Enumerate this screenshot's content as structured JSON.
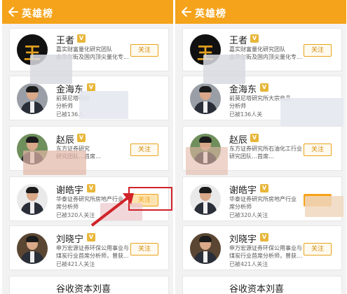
{
  "app": {
    "title": "英雄榜",
    "accent_color": "#f5a31a",
    "back_icon": "arrow-left-icon"
  },
  "experts_left": [
    {
      "name": "王者",
      "badge": "V",
      "desc1": "嘉实财富量化研究团队",
      "desc2": "由华尔街及国内顶尖量化专...",
      "followers": "",
      "follow": "关注",
      "avatar": "logo"
    },
    {
      "name": "金海东",
      "badge": "V",
      "desc1": "前莫尼塔研究",
      "desc2": "分析师",
      "followers": "已被136人",
      "follow": "",
      "avatar": "person"
    },
    {
      "name": "赵辰",
      "badge": "V",
      "desc1": "东方证券研究",
      "desc2": "研究团队…首席…",
      "followers": "",
      "follow": "关注",
      "avatar": "person"
    },
    {
      "name": "谢皓宇",
      "badge": "V",
      "desc1": "华泰证券研究所房地产行业",
      "desc2": "席分析师",
      "followers": "已被320人关注",
      "follow": "关注",
      "avatar": "person"
    },
    {
      "name": "刘晓宁",
      "badge": "V",
      "desc1": "申万宏源证券环保公用事业与",
      "desc2": "煤炭行业首席分析师，曾获...",
      "followers": "已被421人关注",
      "follow": "关注",
      "avatar": "person"
    },
    {
      "name": "谷收资本刘喜",
      "partial": true
    }
  ],
  "experts_right": [
    {
      "name": "王者",
      "badge": "V",
      "desc1": "嘉实财富量化研究团队",
      "desc2": "由华尔街及国内顶尖量化专...",
      "follow": "关注",
      "avatar": "logo"
    },
    {
      "name": "金海东",
      "badge": "V",
      "desc1": "前莫尼塔研究所大宗商品",
      "desc2": "分析师",
      "followers": "已被136人关",
      "avatar": "person"
    },
    {
      "name": "赵辰",
      "badge": "V",
      "desc1": "东方证券研究所石油化工行业",
      "desc2": "研究团队…首席…",
      "follow": "关注",
      "avatar": "person"
    },
    {
      "name": "谢皓宇",
      "badge": "V",
      "desc1": "华泰证券研究所房地产行业",
      "desc2": "席分析师",
      "followers": "已被320人关注",
      "avatar": "person"
    },
    {
      "name": "刘晓宇",
      "badge": "V",
      "desc1": "申万宏源证券环保公用事业与",
      "desc2": "煤炭行业首席分析师，曾获...",
      "followers": "已被421人关注",
      "follow": "关注",
      "avatar": "person"
    },
    {
      "name": "谷收资本刘喜",
      "partial": true
    }
  ],
  "annotation": {
    "highlight_color": "#d0232a",
    "pending_button_label": "关注"
  }
}
